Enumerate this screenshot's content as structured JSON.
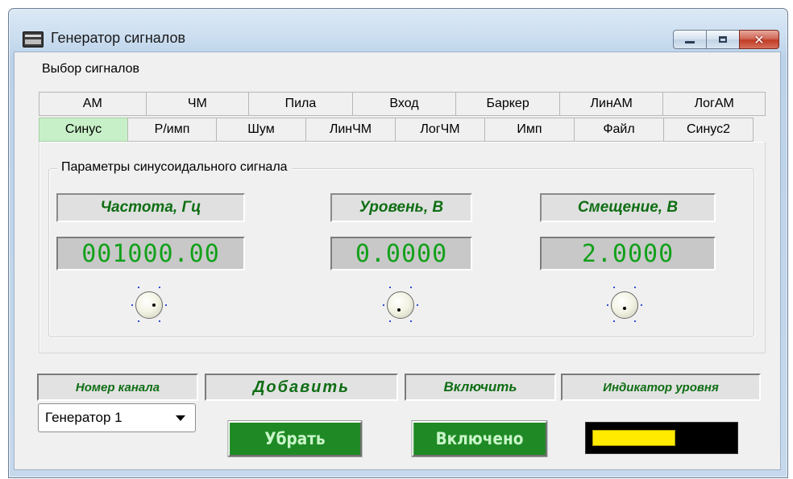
{
  "window": {
    "title": "Генератор сигналов",
    "controls": [
      "minimize",
      "maximize",
      "close"
    ]
  },
  "signal_select": {
    "label": "Выбор сигналов",
    "tabs_row1": [
      "АМ",
      "ЧМ",
      "Пила",
      "Вход",
      "Баркер",
      "ЛинАМ",
      "ЛогАМ"
    ],
    "tabs_row2": [
      "Синус",
      "Р/имп",
      "Шум",
      "ЛинЧМ",
      "ЛогЧМ",
      "Имп",
      "Файл",
      "Синус2"
    ],
    "active_tab": "Синус"
  },
  "params": {
    "legend": "Параметры синусоидального сигнала",
    "frequency": {
      "label": "Частота, Гц",
      "value": "001000.00"
    },
    "level": {
      "label": "Уровень, В",
      "value": "0.0000"
    },
    "offset": {
      "label": "Смещение, В",
      "value": "2.0000"
    }
  },
  "bottom": {
    "channel_label": "Номер канала",
    "add_label": "Добавить",
    "enable_label": "Включить",
    "level_indicator_label": "Индикатор уровня",
    "channel_select": {
      "value": "Генератор 1"
    },
    "remove_button": "Убрать",
    "enabled_button": "Включено",
    "level_fraction": 0.6
  },
  "colors": {
    "lcd_text": "#12a01a",
    "label_text": "#0f6e14",
    "active_tab": "#c8f0c8",
    "button_green": "#1f8a25",
    "level_fill": "#ffeb00"
  }
}
